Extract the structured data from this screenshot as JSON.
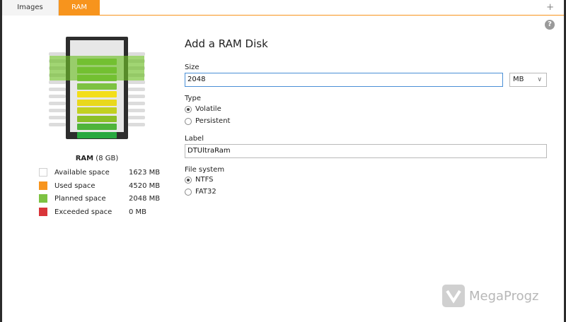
{
  "tabs": [
    {
      "label": "Images",
      "active": false
    },
    {
      "label": "RAM",
      "active": true
    }
  ],
  "add_tab_label": "+",
  "help_label": "?",
  "ram_summary": {
    "title_bold": "RAM",
    "title_rest": " (8 GB)",
    "legend": [
      {
        "label": "Available space",
        "value": "1623 MB",
        "color": "#ffffff"
      },
      {
        "label": "Used space",
        "value": "4520 MB",
        "color": "#f7941d"
      },
      {
        "label": "Planned space",
        "value": "2048 MB",
        "color": "#7dc242"
      },
      {
        "label": "Exceeded space",
        "value": "0 MB",
        "color": "#d9353a"
      }
    ],
    "chip_bar_colors": [
      "#7dc242",
      "#7dc242",
      "#7dc242",
      "#7dc242",
      "#f3de1a",
      "#e9d81c",
      "#c2d020",
      "#8bbf28",
      "#4fb43a",
      "#27a83f"
    ]
  },
  "form": {
    "title": "Add a RAM Disk",
    "size_label": "Size",
    "size_value": "2048",
    "size_unit": "MB",
    "type_label": "Type",
    "type_options": [
      {
        "label": "Volatile",
        "selected": true
      },
      {
        "label": "Persistent",
        "selected": false
      }
    ],
    "label_label": "Label",
    "label_value": "DTUltraRam",
    "fs_label": "File system",
    "fs_options": [
      {
        "label": "NTFS",
        "selected": true
      },
      {
        "label": "FAT32",
        "selected": false
      }
    ]
  },
  "watermark": {
    "text": "MegaProgz"
  }
}
